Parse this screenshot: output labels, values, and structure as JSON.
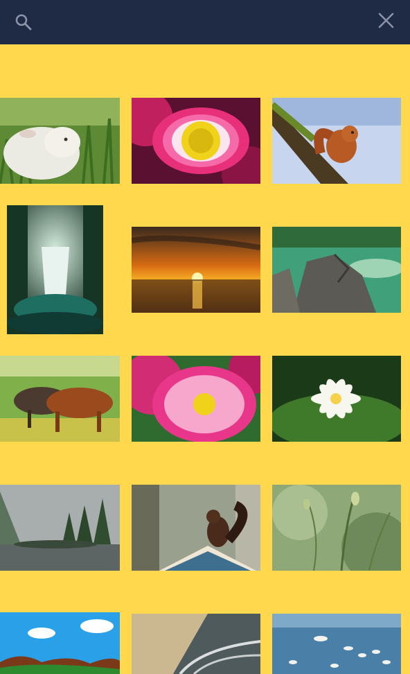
{
  "toolbar": {
    "search_icon": "search-icon",
    "close_icon": "close-icon"
  },
  "colors": {
    "background": "#FFD84D",
    "toolbar": "#1F2A44",
    "icon": "#8C93A8"
  },
  "gallery": {
    "items": [
      {
        "subject": "lamb"
      },
      {
        "subject": "pink-daisy"
      },
      {
        "subject": "red-squirrel-on-branch"
      },
      {
        "subject": "forest-waterfall"
      },
      {
        "subject": "sunset-over-sea"
      },
      {
        "subject": "rocky-green-lake"
      },
      {
        "subject": "horses-grazing"
      },
      {
        "subject": "pink-daisy-close-up"
      },
      {
        "subject": "white-water-lily"
      },
      {
        "subject": "misty-lake-forest"
      },
      {
        "subject": "squirrel-on-birdhouse"
      },
      {
        "subject": "green-grass-stems"
      },
      {
        "subject": "cartoon-landscape"
      },
      {
        "subject": "beach-waves"
      },
      {
        "subject": "seagulls-on-water"
      }
    ]
  }
}
